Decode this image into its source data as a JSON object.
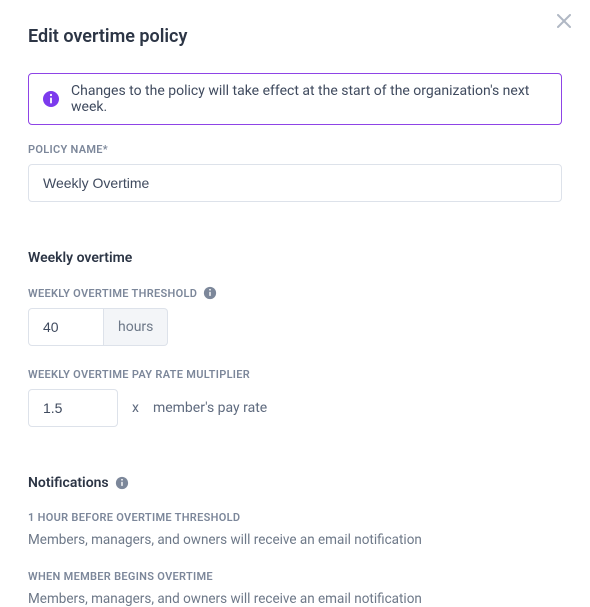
{
  "dialog": {
    "title": "Edit overtime policy"
  },
  "alert": {
    "text": "Changes to the policy will take effect at the start of the organization's next week."
  },
  "policy_name": {
    "label": "POLICY NAME*",
    "value": "Weekly Overtime"
  },
  "weekly": {
    "section_title": "Weekly overtime",
    "threshold": {
      "label": "WEEKLY OVERTIME THRESHOLD",
      "value": "40",
      "unit": "hours"
    },
    "multiplier": {
      "label": "WEEKLY OVERTIME PAY RATE MULTIPLIER",
      "value": "1.5",
      "prefix": "x",
      "suffix": "member's pay rate"
    }
  },
  "notifications": {
    "section_title": "Notifications",
    "items": [
      {
        "heading": "1 HOUR BEFORE OVERTIME THRESHOLD",
        "description": "Members, managers, and owners will receive an email notification"
      },
      {
        "heading": "WHEN MEMBER BEGINS OVERTIME",
        "description": "Members, managers, and owners will receive an email notification"
      }
    ]
  }
}
